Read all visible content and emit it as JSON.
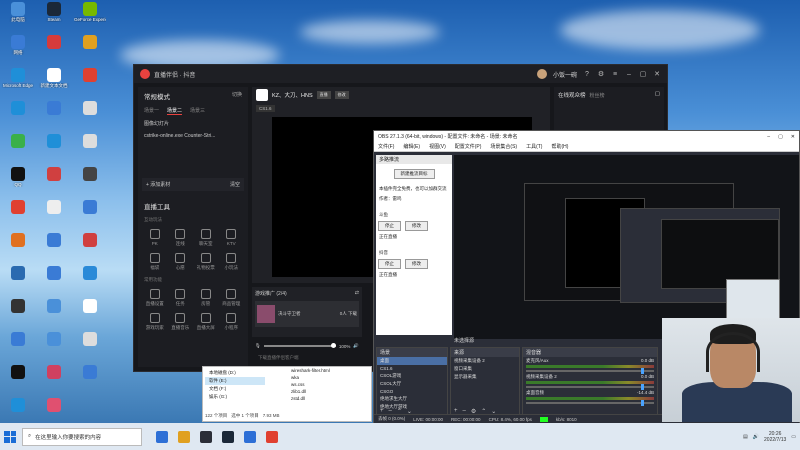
{
  "desktop": {
    "icons": [
      {
        "label": "此电脑",
        "color": "#4a90d9"
      },
      {
        "label": "Steam",
        "color": "#1b2838"
      },
      {
        "label": "GeForce Experience",
        "color": "#76b900"
      },
      {
        "label": "网络",
        "color": "#3a7bd5"
      },
      {
        "label": "",
        "color": "#d63b3b"
      },
      {
        "label": "",
        "color": "#e0a020"
      },
      {
        "label": "Microsoft Edge",
        "color": "#1f8fd8"
      },
      {
        "label": "新建文本文档",
        "color": "#ffffff"
      },
      {
        "label": "",
        "color": "#e04030"
      },
      {
        "label": "",
        "color": "#1f8fd8"
      },
      {
        "label": "",
        "color": "#3a7bd5"
      },
      {
        "label": "",
        "color": "#dddddd"
      },
      {
        "label": "",
        "color": "#3ab04a"
      },
      {
        "label": "",
        "color": "#1f8fd8"
      },
      {
        "label": "",
        "color": "#dddddd"
      },
      {
        "label": "QQ",
        "color": "#111111"
      },
      {
        "label": "",
        "color": "#d04040"
      },
      {
        "label": "",
        "color": "#444444"
      },
      {
        "label": "",
        "color": "#e04030"
      },
      {
        "label": "",
        "color": "#eeeeee"
      },
      {
        "label": "",
        "color": "#3a7bd5"
      },
      {
        "label": "",
        "color": "#e07020"
      },
      {
        "label": "",
        "color": "#3a7bd5"
      },
      {
        "label": "",
        "color": "#d04040"
      },
      {
        "label": "",
        "color": "#2a6ab0"
      },
      {
        "label": "",
        "color": "#3a7bd5"
      },
      {
        "label": "",
        "color": "#2a8ad8"
      },
      {
        "label": "",
        "color": "#333333"
      },
      {
        "label": "",
        "color": "#4a90d9"
      },
      {
        "label": "",
        "color": "#ffffff"
      },
      {
        "label": "",
        "color": "#3a7bd5"
      },
      {
        "label": "",
        "color": "#4a90d9"
      },
      {
        "label": "",
        "color": "#dddddd"
      },
      {
        "label": "",
        "color": "#111111"
      },
      {
        "label": "",
        "color": "#d04060"
      },
      {
        "label": "",
        "color": "#3a7bd5"
      },
      {
        "label": "",
        "color": "#1f8fd8"
      },
      {
        "label": "",
        "color": "#e05070"
      }
    ]
  },
  "live": {
    "title": "直播伴侣 · 抖音",
    "user": "小饭一碗",
    "mode": "常规模式",
    "switch": "切换",
    "scene_tabs": [
      "场景一",
      "场景二",
      "场景三"
    ],
    "sources": [
      "图像幻灯片",
      "cstrike-online.exe Counter-Stri..."
    ],
    "add_source": "+ 添加素材",
    "clear": "清空",
    "tools_title": "直播工具",
    "interact_label": "互动玩法",
    "tools_row1": [
      "PK",
      "连线",
      "聊天室",
      "KTV"
    ],
    "tools_row2": [
      "福袋",
      "心愿",
      "礼物投票",
      "小玩法"
    ],
    "feature_label": "常用功能",
    "tools_row3": [
      "直播设置",
      "任务",
      "房管",
      "商品管理"
    ],
    "tools_row4": [
      "游戏玩家",
      "直播音乐",
      "直播大屏",
      "小程序"
    ],
    "streamer_name": "KZ、大刀、HNS",
    "streamer_chip": "直播",
    "streamer_chip2": "修改",
    "category": "CS1.6",
    "viewers_title": "在线观众榜",
    "viewers_sub": "粉丝榜",
    "promo_title": "游戏推广 (2/4)",
    "promo_game": "决斗守卫者",
    "promo_count": "0人 下载",
    "volume": "100%",
    "hint": "下载直播伴侣客户端"
  },
  "explorer": {
    "drives": [
      "本地磁盘 (D:)",
      "软件 (E:)",
      "文档 (F:)",
      "娱乐 (G:)"
    ],
    "files": [
      "wireshark-filter.html",
      "wka",
      "ws.css",
      "zlib1.dll",
      "zstd.dll"
    ],
    "status_count": "122 个项目",
    "status_sel": "选中 1 个项目",
    "status_size": "7.93 MB"
  },
  "obs": {
    "title": "OBS 27.1.3 (64-bit, windows) - 配置文件: 未命名 - 场景: 未命名",
    "menu": [
      "文件(F)",
      "编辑(E)",
      "视图(V)",
      "配置文件(P)",
      "场景集合(S)",
      "工具(T)",
      "帮助(H)"
    ],
    "dock_title": "多路推流",
    "dock_new": "新建推流目标",
    "dock_text": "本插件完全免费，也可以加群交流",
    "dock_author": "作者：雷鸣",
    "target1": "斗鱼",
    "target2": "抖音",
    "stop": "停止",
    "modify": "修改",
    "running": "正在直播",
    "scene_label": "未选择源",
    "scenes_title": "场景",
    "scenes": [
      "桌面",
      "CS1.6",
      "CSOL游戏",
      "CSOL大厅",
      "CSGO",
      "绝地求生大厅",
      "绝地大厅游戏"
    ],
    "sources_title": "来源",
    "sources": [
      "视频采集设备 2",
      "窗口采集",
      "显示器采集"
    ],
    "mixer_title": "混音器",
    "mixer": [
      {
        "name": "麦克风/Aux",
        "db": "0.0 dB"
      },
      {
        "name": "视频采集设备 2",
        "db": "0.0 dB"
      },
      {
        "name": "桌面音频",
        "db": "-14.4 dB"
      }
    ],
    "status": [
      "丢帧 0 (0.0%)",
      "LIVE: 00:00:00",
      "REC: 00:00:00",
      "CPU: 8.4%, 60.00 fps",
      "kb/s: 8010"
    ]
  },
  "taskbar": {
    "search_placeholder": "在这里输入你要搜索的内容",
    "time": "20:26",
    "date": "2022/7/13",
    "icons": [
      {
        "color": "#2d6fd6"
      },
      {
        "color": "#e0a020"
      },
      {
        "color": "#2b2e38"
      },
      {
        "color": "#1b2838"
      },
      {
        "color": "#2d6fd6"
      },
      {
        "color": "#e04030"
      }
    ]
  }
}
